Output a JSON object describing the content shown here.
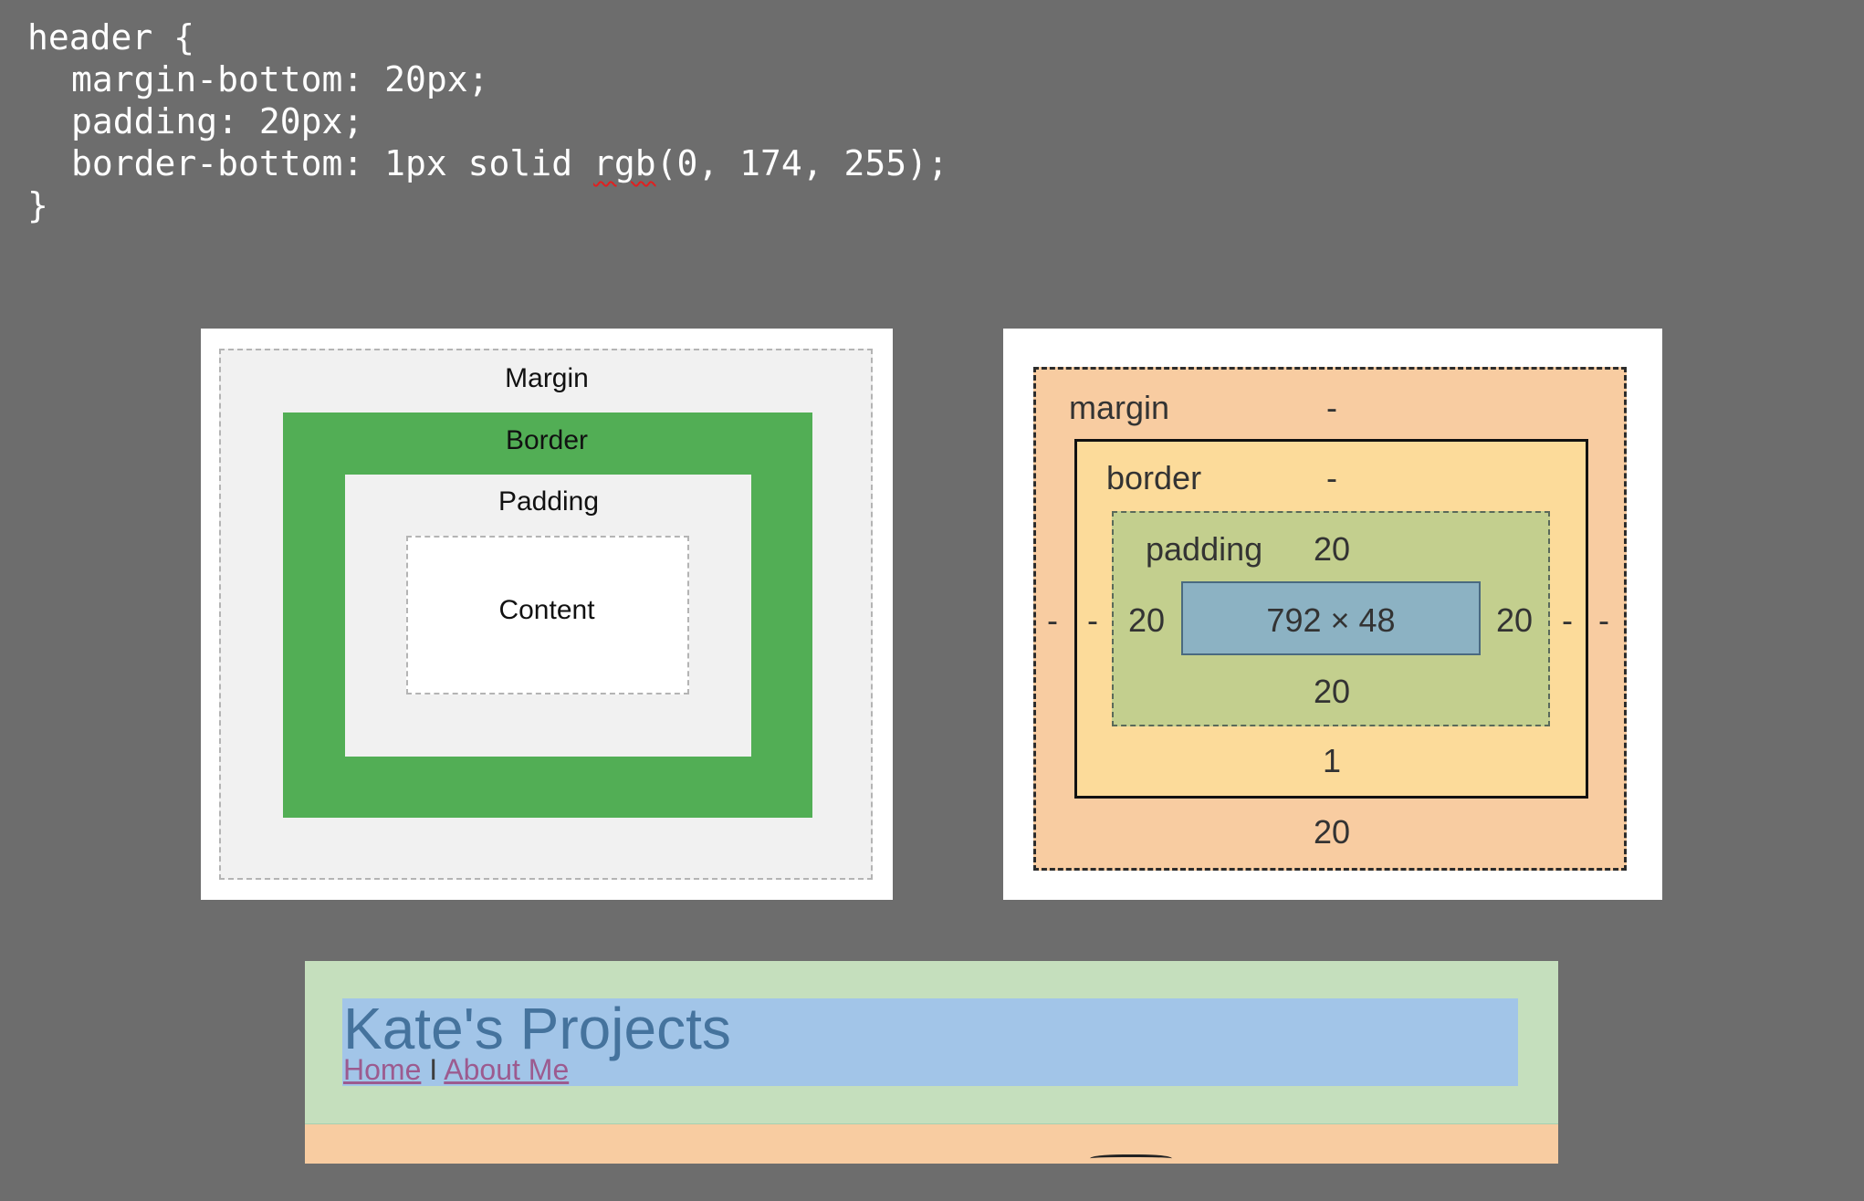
{
  "code": {
    "line1": "header {",
    "line2": "margin-bottom: 20px;",
    "line3": "padding: 20px;",
    "line4_prefix": "border-bottom: 1px solid ",
    "line4_func": "rgb",
    "line4_args": "(0, 174, 255);",
    "line5": "}"
  },
  "box_model_generic": {
    "margin": "Margin",
    "border": "Border",
    "padding": "Padding",
    "content": "Content",
    "colors": {
      "margin": "#f1f1f1",
      "border": "#52ae55",
      "padding": "#f1f1f1",
      "content": "#ffffff"
    }
  },
  "box_model_devtools": {
    "margin_label": "margin",
    "margin_top": "-",
    "margin_left": "-",
    "margin_right": "-",
    "margin_bottom": "20",
    "border_label": "border",
    "border_top": "-",
    "border_left": "-",
    "border_right": "-",
    "border_bottom": "1",
    "padding_label": "padding",
    "padding_top": "20",
    "padding_left": "20",
    "padding_right": "20",
    "padding_bottom": "20",
    "content_size": "792 × 48",
    "colors": {
      "margin": "#f8cca1",
      "border": "#fcdb9a",
      "padding": "#c3cf8e",
      "content": "#8cb2c3"
    }
  },
  "site_header": {
    "title": "Kate's Projects",
    "nav_home": "Home",
    "nav_separator": "I",
    "nav_about": "About Me"
  }
}
